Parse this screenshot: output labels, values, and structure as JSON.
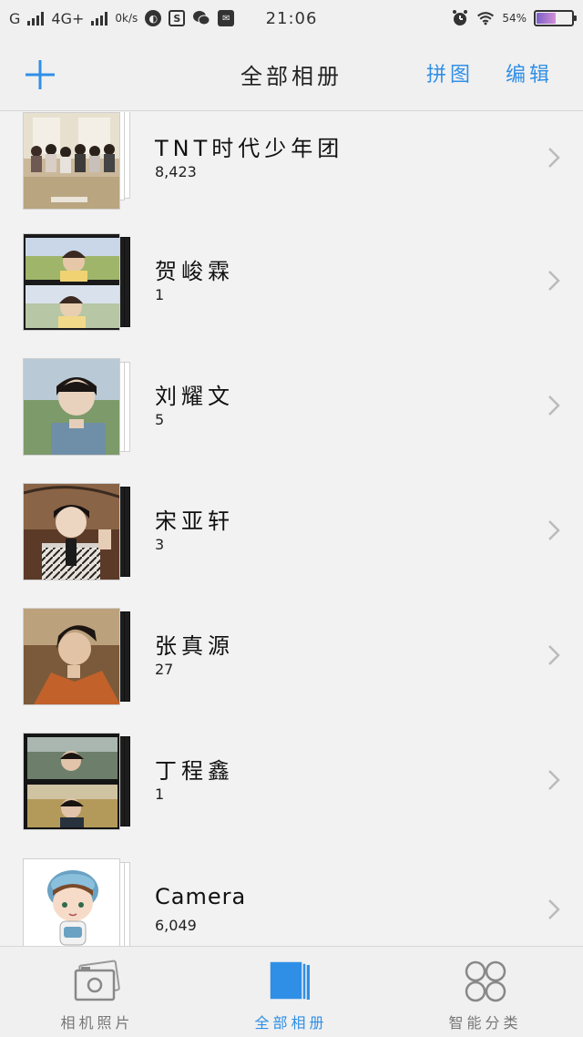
{
  "status_bar": {
    "network_g": "G",
    "network_4g": "4G+",
    "speed": "0k/s",
    "time": "21:06",
    "battery_level": "54%"
  },
  "header": {
    "title": "全部相册",
    "collage_label": "拼图",
    "edit_label": "编辑"
  },
  "albums": [
    {
      "name": "TNT时代少年团",
      "count": "8,423"
    },
    {
      "name": "贺峻霖",
      "count": "1"
    },
    {
      "name": "刘耀文",
      "count": "5"
    },
    {
      "name": "宋亚轩",
      "count": "3"
    },
    {
      "name": "张真源",
      "count": "27"
    },
    {
      "name": "丁程鑫",
      "count": "1"
    },
    {
      "name": "Camera",
      "count": "6,049"
    }
  ],
  "bottom_nav": {
    "tabs": [
      {
        "label": "相机照片",
        "icon": "camera-photos-icon"
      },
      {
        "label": "全部相册",
        "icon": "all-albums-icon"
      },
      {
        "label": "智能分类",
        "icon": "smart-category-icon"
      }
    ],
    "active_index": 1
  },
  "colors": {
    "accent": "#2f8fe6",
    "background": "#f2f2f2"
  }
}
